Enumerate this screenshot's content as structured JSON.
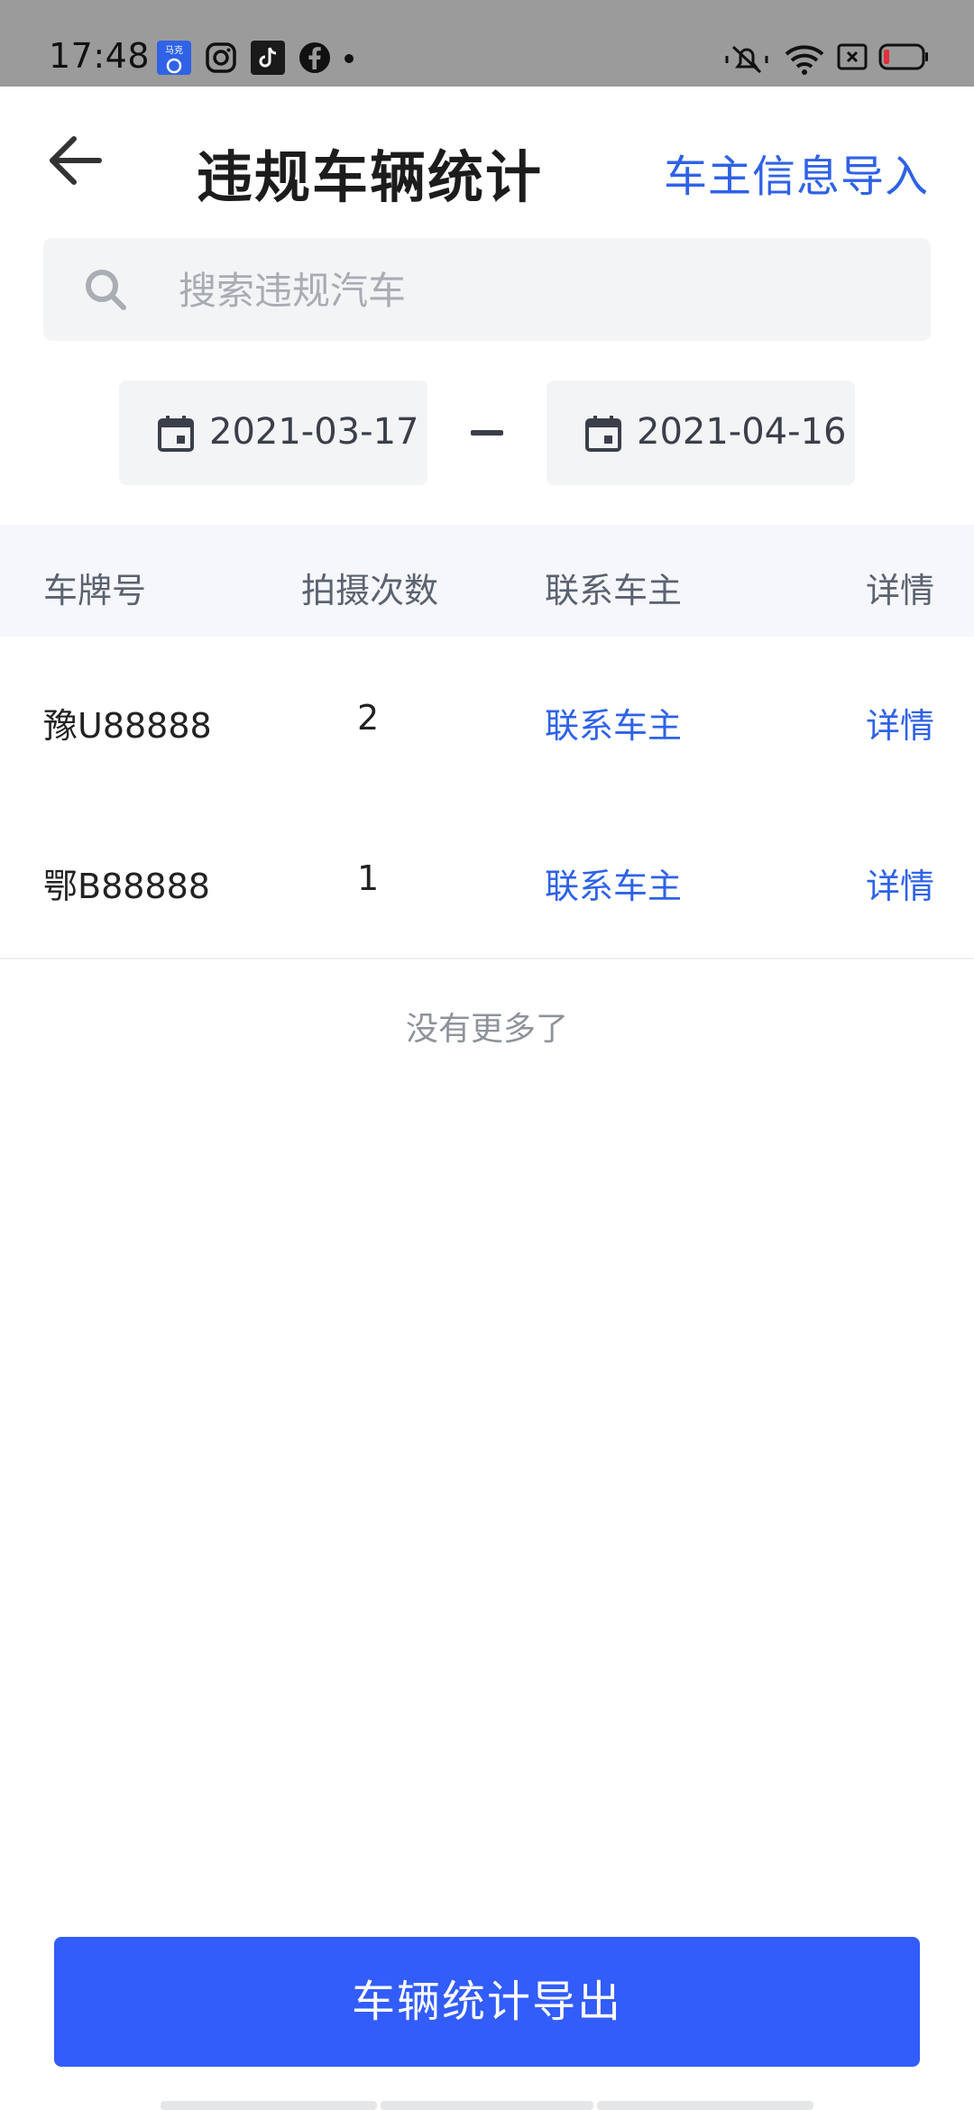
{
  "status_bar": {
    "time": "17:48",
    "badge_text": "马克"
  },
  "header": {
    "title": "违规车辆统计",
    "action_label": "车主信息导入"
  },
  "search": {
    "placeholder": "搜索违规汽车",
    "value": ""
  },
  "date_range": {
    "start": "2021-03-17",
    "end": "2021-04-16"
  },
  "table": {
    "columns": [
      "车牌号",
      "拍摄次数",
      "联系车主",
      "详情"
    ],
    "rows": [
      {
        "plate": "豫U88888",
        "count": "2",
        "contact": "联系车主",
        "detail": "详情"
      },
      {
        "plate": "鄂B88888",
        "count": "1",
        "contact": "联系车主",
        "detail": "详情"
      }
    ]
  },
  "footer_note": "没有更多了",
  "export_button": "车辆统计导出",
  "colors": {
    "accent": "#2f62e6",
    "button": "#325dfa",
    "status_bar": "#9b9b9b"
  },
  "icons": [
    "app-badge-icon",
    "instagram-icon",
    "tiktok-icon",
    "facebook-icon",
    "mute-icon",
    "wifi-icon",
    "sim-icon",
    "battery-icon",
    "back-arrow-icon",
    "search-icon",
    "calendar-icon"
  ]
}
